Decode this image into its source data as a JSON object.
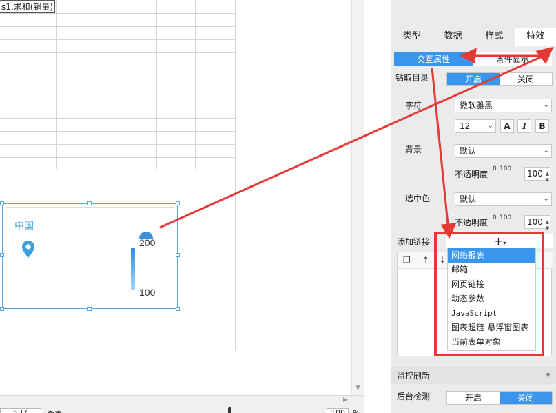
{
  "canvas": {
    "formula_cell": "s1.求和(销量)",
    "map_widget": {
      "title": "中国",
      "legend_max": "200",
      "legend_min": "100"
    }
  },
  "statusbar": {
    "size_value": "537",
    "size_unit": "像素",
    "zoom_value": "100",
    "zoom_unit": "%"
  },
  "panel": {
    "tabs": [
      "类型",
      "数据",
      "样式",
      "特效"
    ],
    "active_tab": "特效",
    "subtabs": [
      "交互属性",
      "条件显示"
    ],
    "drill": {
      "label": "钻取目录",
      "on": "开启",
      "off": "关闭",
      "state": "on"
    },
    "font": {
      "label": "字符",
      "family": "微软雅黑",
      "size": "12",
      "bold": "B",
      "italic": "I",
      "color_glyph": "A"
    },
    "background": {
      "label": "背景",
      "value": "默认",
      "opacity_label": "不透明度",
      "range_min": "0",
      "range_max": "100",
      "opacity_value": "100"
    },
    "selected_color": {
      "label": "选中色",
      "value": "默认",
      "opacity_label": "不透明度",
      "range_min": "0",
      "range_max": "100",
      "opacity_value": "100"
    },
    "add_link": {
      "label": "添加链接",
      "menu": [
        "网络报表",
        "邮箱",
        "网页链接",
        "动态参数",
        "JavaScript",
        "图表超链-悬浮窗图表",
        "当前表单对象"
      ],
      "highlighted_index": 0
    },
    "monitor": {
      "section_label": "监控刷新",
      "backend_label": "后台检测",
      "on": "开启",
      "off": "关闭",
      "state": "off"
    }
  },
  "colors": {
    "accent": "#3a96ec",
    "annotation": "#e53935",
    "map_title": "#3ea0dd"
  }
}
